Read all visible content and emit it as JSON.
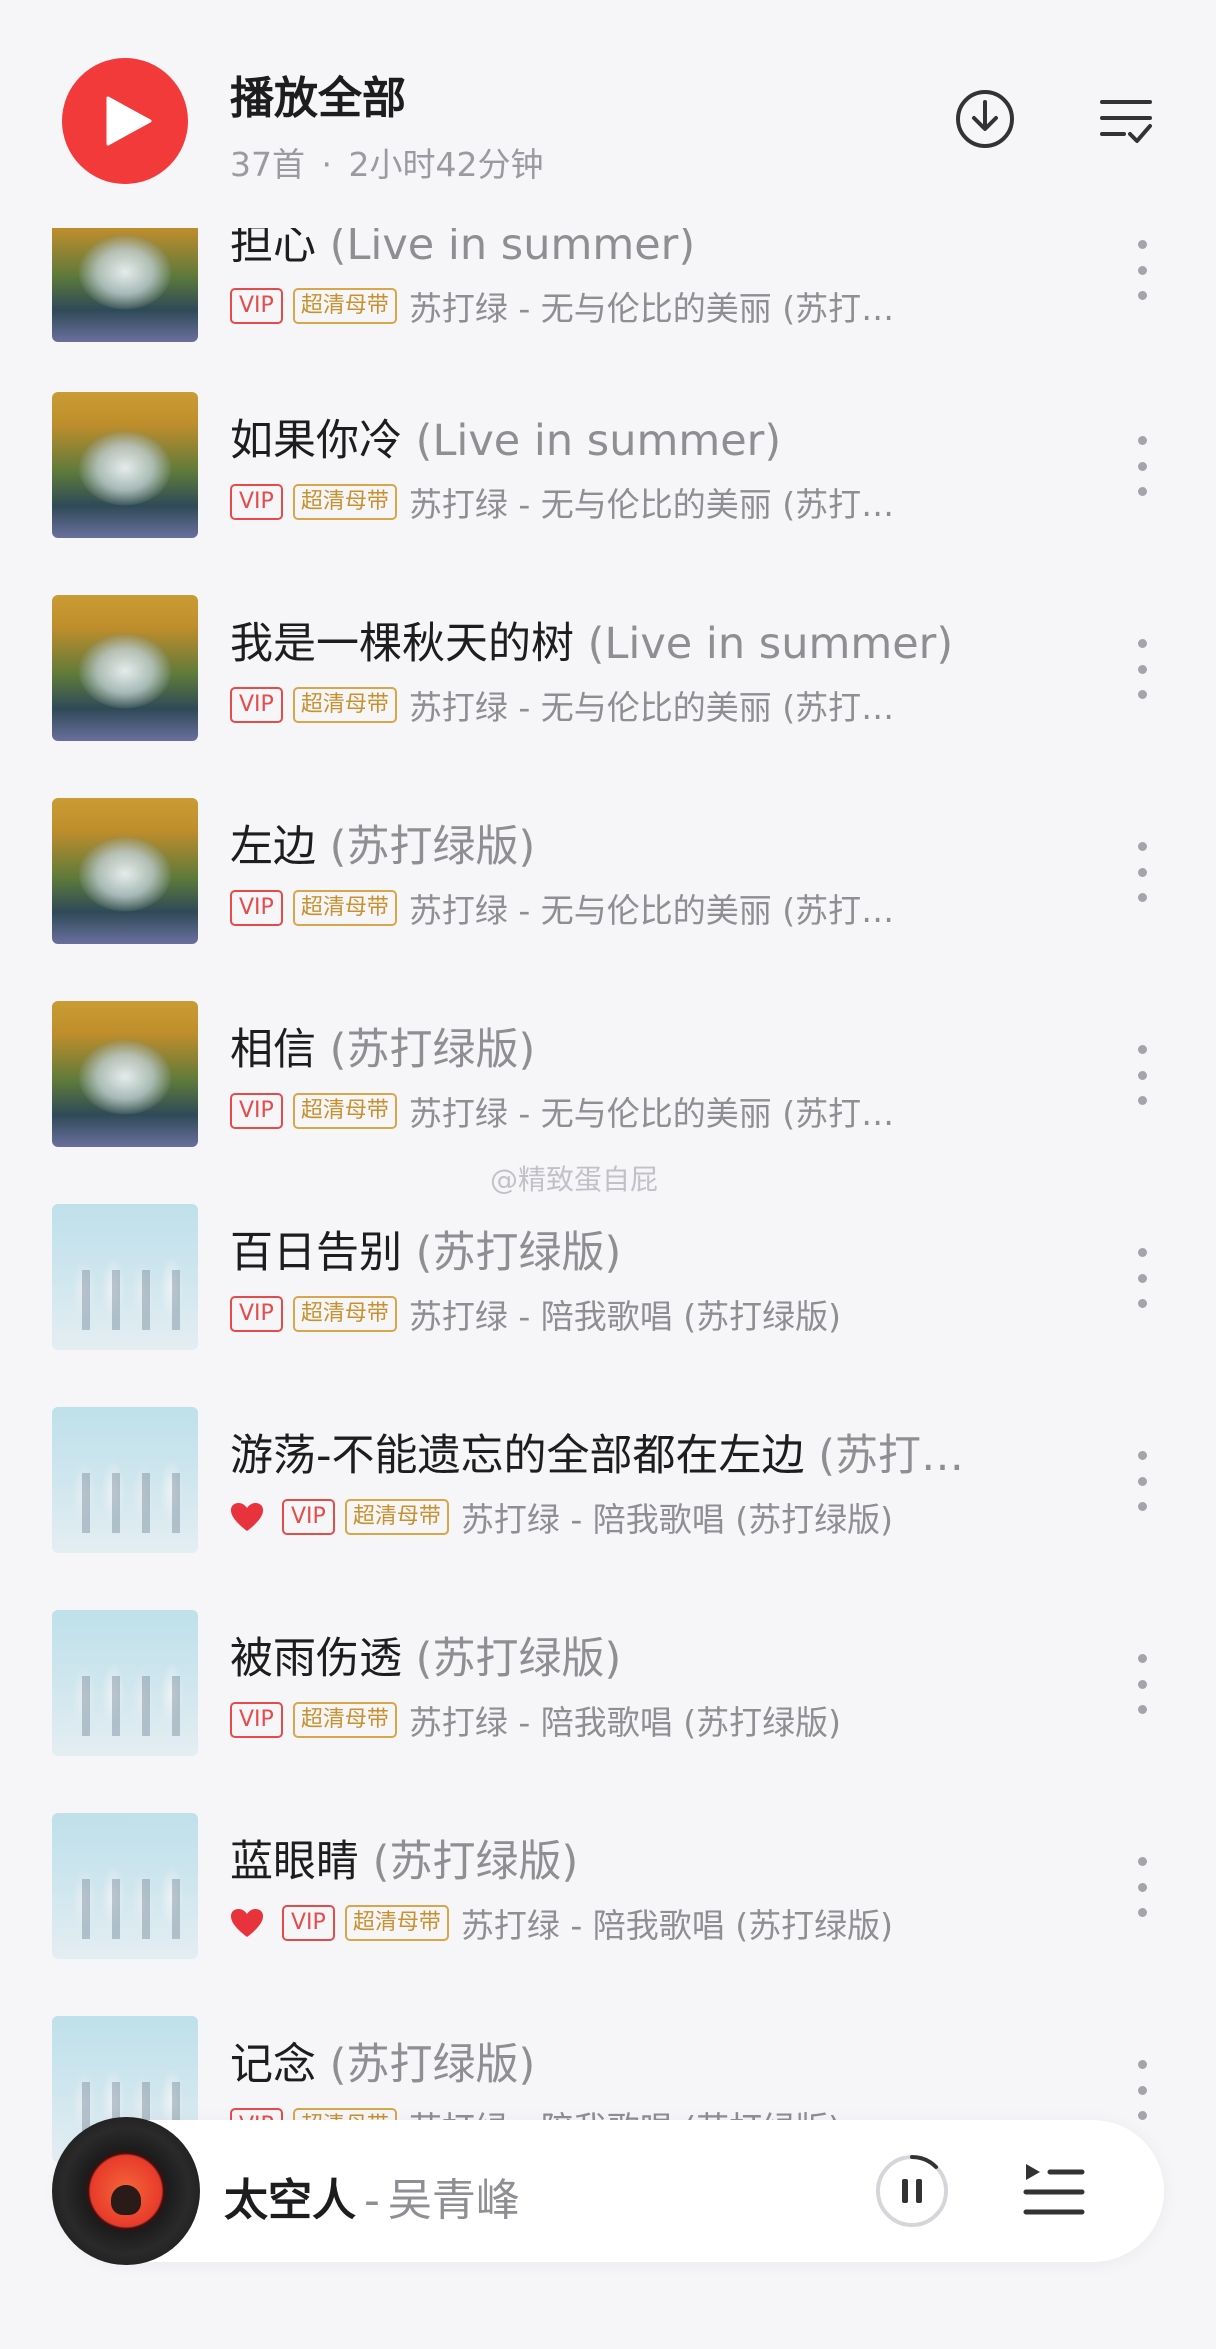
{
  "header": {
    "title": "播放全部",
    "track_count": "37首",
    "dot": "·",
    "duration": "2小时42分钟"
  },
  "badges": {
    "vip": "VIP",
    "sq": "超清母带"
  },
  "songs": [
    {
      "title": "担心",
      "suffix": "(Live in summer)",
      "liked": false,
      "artist_album": "苏打绿 - 无与伦比的美丽 (苏打…",
      "cover": "type-a"
    },
    {
      "title": "如果你冷",
      "suffix": "(Live in summer)",
      "liked": false,
      "artist_album": "苏打绿 - 无与伦比的美丽 (苏打…",
      "cover": "type-a"
    },
    {
      "title": "我是一棵秋天的树",
      "suffix": "(Live in summer)",
      "liked": false,
      "artist_album": "苏打绿 - 无与伦比的美丽 (苏打…",
      "cover": "type-a"
    },
    {
      "title": "左边",
      "suffix": "(苏打绿版)",
      "liked": false,
      "artist_album": "苏打绿 - 无与伦比的美丽 (苏打…",
      "cover": "type-a"
    },
    {
      "title": "相信",
      "suffix": "(苏打绿版)",
      "liked": false,
      "artist_album": "苏打绿 - 无与伦比的美丽 (苏打…",
      "cover": "type-a"
    },
    {
      "title": "百日告别",
      "suffix": "(苏打绿版)",
      "liked": false,
      "artist_album": "苏打绿 - 陪我歌唱 (苏打绿版)",
      "cover": "type-b"
    },
    {
      "title": "游荡-不能遗忘的全部都在左边",
      "suffix": "(苏打…",
      "liked": true,
      "artist_album": "苏打绿 - 陪我歌唱 (苏打绿版)",
      "cover": "type-b"
    },
    {
      "title": "被雨伤透",
      "suffix": "(苏打绿版)",
      "liked": false,
      "artist_album": "苏打绿 - 陪我歌唱 (苏打绿版)",
      "cover": "type-b"
    },
    {
      "title": "蓝眼睛",
      "suffix": "(苏打绿版)",
      "liked": true,
      "artist_album": "苏打绿 - 陪我歌唱 (苏打绿版)",
      "cover": "type-b"
    },
    {
      "title": "记念",
      "suffix": "(苏打绿版)",
      "liked": false,
      "artist_album": "苏打绿 - 陪我歌唱 (苏打绿版)",
      "cover": "type-b"
    }
  ],
  "watermark": "@精致蛋自屁",
  "now_playing": {
    "song": "太空人",
    "separator": "-",
    "artist": "吴青峰"
  },
  "colors": {
    "accent_red": "#f23a3a",
    "vip_red": "#e64b4b",
    "sq_gold": "#c9912e"
  }
}
